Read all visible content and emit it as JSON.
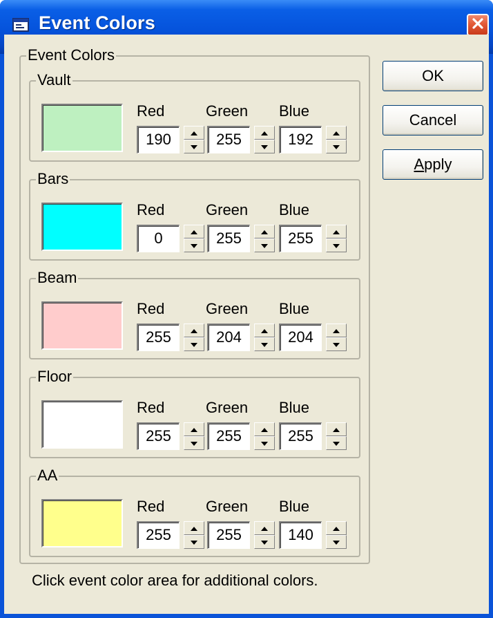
{
  "window": {
    "title": "Event Colors",
    "icon": "dialog-app-icon",
    "close_icon": "close-x-icon"
  },
  "outer_group": {
    "label": "Event Colors"
  },
  "channel_labels": {
    "red": "Red",
    "green": "Green",
    "blue": "Blue"
  },
  "events": [
    {
      "label": "Vault",
      "red": "190",
      "green": "255",
      "blue": "192",
      "color": "#bef0c0"
    },
    {
      "label": "Bars",
      "red": "0",
      "green": "255",
      "blue": "255",
      "color": "#00ffff"
    },
    {
      "label": "Beam",
      "red": "255",
      "green": "204",
      "blue": "204",
      "color": "#ffcccc"
    },
    {
      "label": "Floor",
      "red": "255",
      "green": "255",
      "blue": "255",
      "color": "#ffffff"
    },
    {
      "label": "AA",
      "red": "255",
      "green": "255",
      "blue": "140",
      "color": "#ffff8c"
    }
  ],
  "buttons": {
    "ok": "OK",
    "cancel": "Cancel",
    "apply_accel": "A",
    "apply_rest": "pply"
  },
  "hint": "Click event color area for additional colors.",
  "colors": {
    "titlebar": "#0553dc",
    "dialog_bg": "#ece9d8",
    "close_button": "#e35b38"
  }
}
